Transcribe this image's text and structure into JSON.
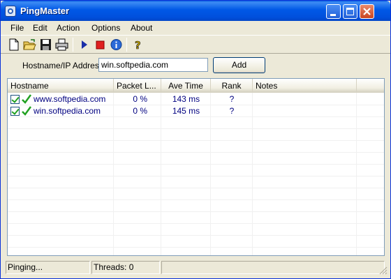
{
  "window": {
    "title": "PingMaster",
    "icon": "app-icon"
  },
  "menu": {
    "items": [
      "File",
      "Edit",
      "Action",
      "Options",
      "About"
    ]
  },
  "toolbar": {
    "buttons": [
      "new-icon",
      "open-icon",
      "save-icon",
      "print-icon",
      "play-icon",
      "stop-icon",
      "info-icon",
      "help-icon"
    ]
  },
  "address": {
    "label": "Hostname/IP Address:",
    "value": "win.softpedia.com",
    "add_label": "Add"
  },
  "table": {
    "columns": [
      "Hostname",
      "Packet L...",
      "Ave Time",
      "Rank",
      "Notes"
    ],
    "rows": [
      {
        "checked": true,
        "status": "ok",
        "hostname": "www.softpedia.com",
        "packet_loss": "0 %",
        "ave_time": "143 ms",
        "rank": "?",
        "notes": ""
      },
      {
        "checked": true,
        "status": "ok",
        "hostname": "win.softpedia.com",
        "packet_loss": "0 %",
        "ave_time": "145 ms",
        "rank": "?",
        "notes": ""
      }
    ]
  },
  "status": {
    "state": "Pinging...",
    "threads": "Threads: 0",
    "extra": ""
  },
  "colors": {
    "titlebar": "#0054e3",
    "row_text": "#000080",
    "check_green": "#21a121"
  }
}
